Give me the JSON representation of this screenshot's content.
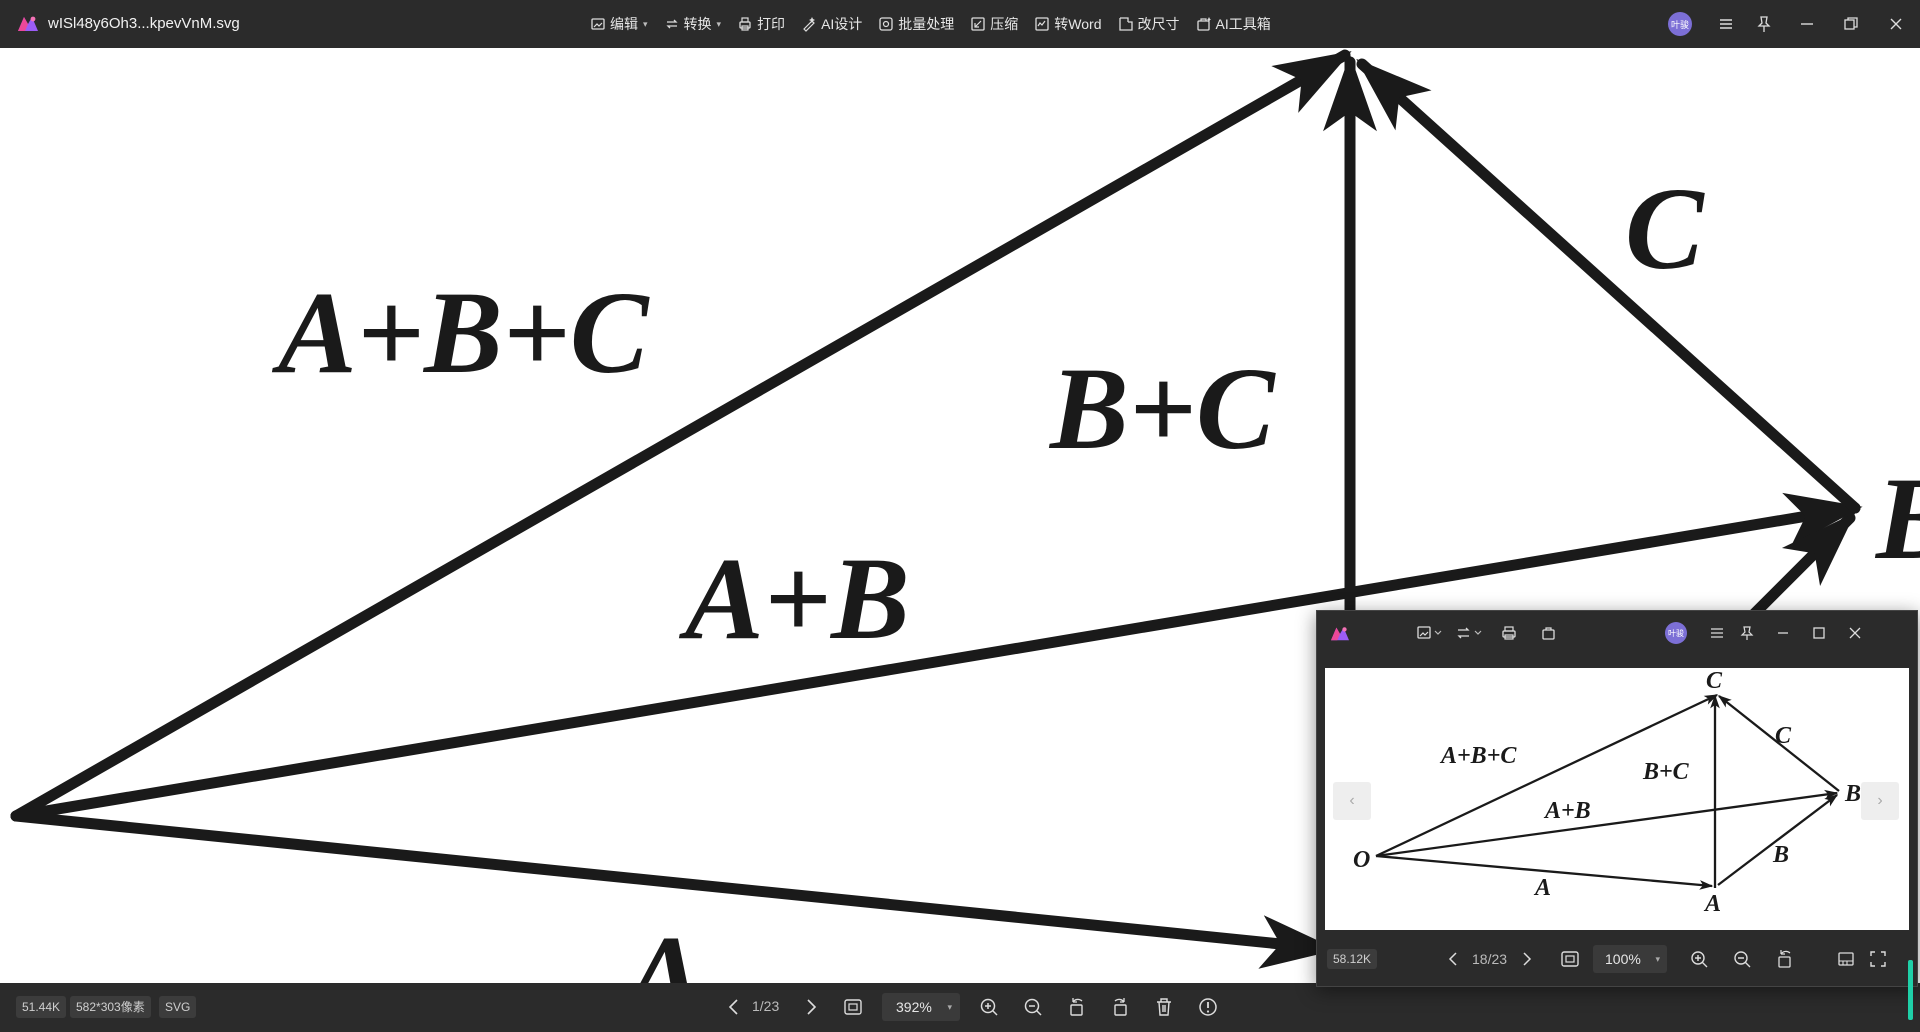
{
  "app": {
    "title": "wISl48y6Oh3...kpevVnM.svg",
    "avatar_text": "叶骏",
    "accent_color": "#7c6fd6"
  },
  "toolbar": [
    {
      "label": "编辑",
      "icon": "image-edit-icon",
      "dropdown": true
    },
    {
      "label": "转换",
      "icon": "convert-icon",
      "dropdown": true
    },
    {
      "label": "打印",
      "icon": "printer-icon",
      "dropdown": false
    },
    {
      "label": "AI设计",
      "icon": "ai-design-icon",
      "dropdown": false
    },
    {
      "label": "批量处理",
      "icon": "batch-icon",
      "dropdown": false
    },
    {
      "label": "压缩",
      "icon": "compress-icon",
      "dropdown": false
    },
    {
      "label": "转Word",
      "icon": "word-icon",
      "dropdown": false
    },
    {
      "label": "改尺寸",
      "icon": "resize-icon",
      "dropdown": false
    },
    {
      "label": "AI工具箱",
      "icon": "ai-toolbox-icon",
      "dropdown": false
    }
  ],
  "diagram": {
    "labels": {
      "abc": "A+B+C",
      "bc": "B+C",
      "c": "C",
      "ab": "A+B",
      "a": "A",
      "b": "B"
    }
  },
  "status": {
    "file_size": "51.44K",
    "dimensions": "582*303像素",
    "format": "SVG",
    "page": "1/23",
    "zoom": "392%"
  },
  "mini_window": {
    "avatar_text": "叶骏",
    "file_size": "58.12K",
    "page": "18/23",
    "zoom": "100%",
    "labels": {
      "c_top": "C",
      "abc": "A+B+C",
      "bc": "B+C",
      "c": "C",
      "b_right": "B",
      "ab": "A+B",
      "o": "O",
      "b": "B",
      "a": "A",
      "a_bottom": "A"
    }
  }
}
